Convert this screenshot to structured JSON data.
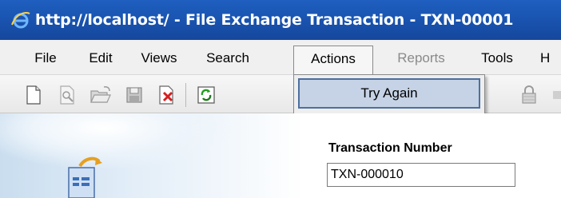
{
  "window": {
    "title": "http://localhost/ - File Exchange Transaction - TXN-00001",
    "browser_icon": "ie-icon"
  },
  "menu": {
    "file": "File",
    "edit": "Edit",
    "views": "Views",
    "search": "Search",
    "actions": "Actions",
    "reports": "Reports",
    "tools": "Tools",
    "help": "H"
  },
  "actions_menu": {
    "items": [
      "Try Again"
    ]
  },
  "toolbar": {
    "icons": [
      "new-icon",
      "print-preview-icon",
      "open-icon",
      "save-icon",
      "delete-icon",
      "refresh-icon",
      "lock-icon"
    ]
  },
  "form": {
    "transaction_number_label": "Transaction Number",
    "transaction_number_value": "TXN-000010"
  },
  "colors": {
    "titlebar": "#1a56b3",
    "menu_highlight": "#c6d3e6",
    "menu_highlight_border": "#4d6f9e"
  }
}
